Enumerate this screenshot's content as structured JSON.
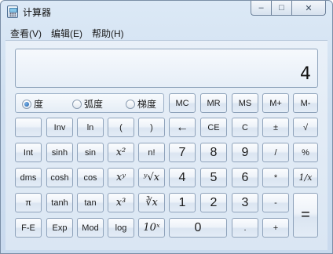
{
  "window": {
    "title": "计算器",
    "minimize": "–",
    "maximize": "□",
    "close": "✕"
  },
  "menu": [
    "查看(V)",
    "编辑(E)",
    "帮助(H)"
  ],
  "display": {
    "value": "4"
  },
  "angle_units": [
    {
      "label": "度",
      "selected": true
    },
    {
      "label": "弧度",
      "selected": false
    },
    {
      "label": "梯度",
      "selected": false
    }
  ],
  "memory_buttons": [
    "MC",
    "MR",
    "MS",
    "M+",
    "M-"
  ],
  "rows": {
    "r1": [
      "",
      "Inv",
      "ln",
      "(",
      ")",
      "←",
      "CE",
      "C",
      "±",
      "√"
    ],
    "r2": [
      "Int",
      "sinh",
      "sin",
      "x²",
      "n!",
      "7",
      "8",
      "9",
      "/",
      "%"
    ],
    "r3": [
      "dms",
      "cosh",
      "cos",
      "xʸ",
      "ʸ√x",
      "4",
      "5",
      "6",
      "*",
      "1/x"
    ],
    "r4": [
      "π",
      "tanh",
      "tan",
      "x³",
      "∛x",
      "1",
      "2",
      "3",
      "-",
      "="
    ],
    "r5": [
      "F-E",
      "Exp",
      "Mod",
      "log",
      "10ˣ",
      "0",
      ".",
      "+"
    ]
  }
}
